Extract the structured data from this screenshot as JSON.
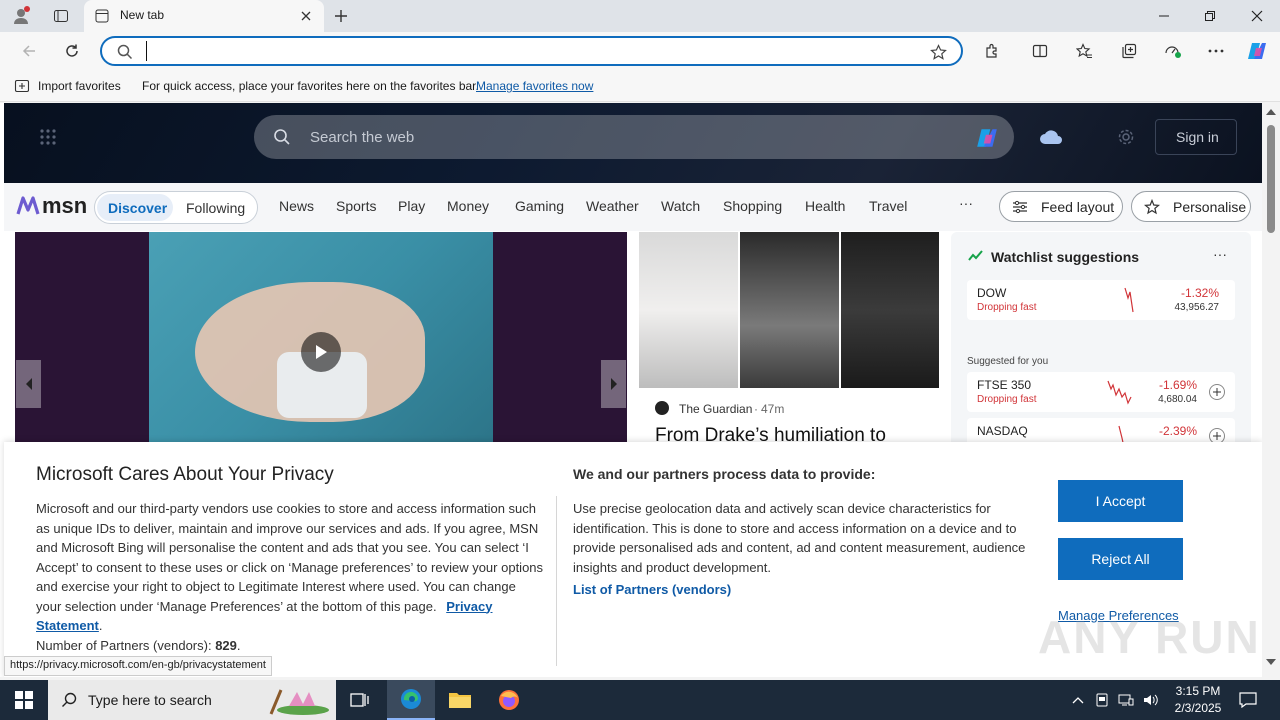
{
  "browser": {
    "tab_title": "New tab",
    "address_value": "",
    "favbar": {
      "import_label": "Import favorites",
      "hint": "For quick access, place your favorites here on the favorites bar.",
      "manage_link": "Manage favorites now"
    }
  },
  "msn": {
    "search_placeholder": "Search the web",
    "sign_in": "Sign in",
    "logo": "msn",
    "tabs": [
      "Discover",
      "Following"
    ],
    "nav": [
      "News",
      "Sports",
      "Play",
      "Money",
      "Gaming",
      "Weather",
      "Watch",
      "Shopping",
      "Health",
      "Travel"
    ],
    "more": "···",
    "feed_layout": "Feed layout",
    "personalise": "Personalise",
    "article": {
      "source": "The Guardian",
      "age": "47m",
      "headline": "From Drake’s humiliation to"
    },
    "watchlist": {
      "title": "Watchlist suggestions",
      "more": "···",
      "suggested_label": "Suggested for you",
      "stocks": [
        {
          "name": "DOW",
          "status": "Dropping fast",
          "change": "-1.32%",
          "value": "43,956.27"
        },
        {
          "name": "FTSE 350",
          "status": "Dropping fast",
          "change": "-1.69%",
          "value": "4,680.04"
        },
        {
          "name": "NASDAQ",
          "status": "",
          "change": "-2.39%",
          "value": ""
        }
      ]
    }
  },
  "privacy": {
    "title": "Microsoft Cares About Your Privacy",
    "body": "Microsoft and our third-party vendors use cookies to store and access information such as unique IDs to deliver, maintain and improve our services and ads. If you agree, MSN and Microsoft Bing will personalise the content and ads that you see. You can select ‘I Accept’ to consent to these uses or click on ‘Manage preferences’ to review your options and exercise your right to object to Legitimate Interest where used.  You can change your selection under ‘Manage Preferences’ at the bottom of this page.",
    "privacy_link": "Privacy Statement",
    "partners_label": "Number of Partners (vendors):",
    "partners_count": "829",
    "section_title": "We and our partners process data to provide:",
    "section_body": "Use precise geolocation data and actively scan device characteristics for identification. This is done to store and access information on a device and to provide personalised ads and content, ad and content measurement, audience insights and product development.",
    "partners_link": "List of Partners (vendors)",
    "accept": "I Accept",
    "reject": "Reject All",
    "manage": "Manage Preferences"
  },
  "status_url": "https://privacy.microsoft.com/en-gb/privacystatement",
  "taskbar": {
    "search_placeholder": "Type here to search",
    "time": "3:15 PM",
    "date": "2/3/2025"
  },
  "watermark": "ANY RUN",
  "colors": {
    "accent": "#0f6cbd",
    "negative": "#d13438",
    "taskbar": "#1c2a3a"
  }
}
